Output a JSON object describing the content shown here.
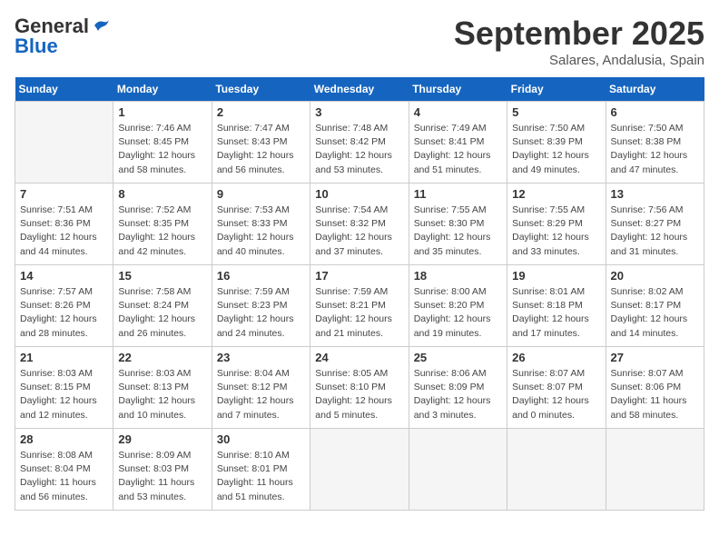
{
  "logo": {
    "line1": "General",
    "line2": "Blue"
  },
  "title": "September 2025",
  "subtitle": "Salares, Andalusia, Spain",
  "days_of_week": [
    "Sunday",
    "Monday",
    "Tuesday",
    "Wednesday",
    "Thursday",
    "Friday",
    "Saturday"
  ],
  "weeks": [
    [
      {
        "day": "",
        "info": ""
      },
      {
        "day": "1",
        "info": "Sunrise: 7:46 AM\nSunset: 8:45 PM\nDaylight: 12 hours\nand 58 minutes."
      },
      {
        "day": "2",
        "info": "Sunrise: 7:47 AM\nSunset: 8:43 PM\nDaylight: 12 hours\nand 56 minutes."
      },
      {
        "day": "3",
        "info": "Sunrise: 7:48 AM\nSunset: 8:42 PM\nDaylight: 12 hours\nand 53 minutes."
      },
      {
        "day": "4",
        "info": "Sunrise: 7:49 AM\nSunset: 8:41 PM\nDaylight: 12 hours\nand 51 minutes."
      },
      {
        "day": "5",
        "info": "Sunrise: 7:50 AM\nSunset: 8:39 PM\nDaylight: 12 hours\nand 49 minutes."
      },
      {
        "day": "6",
        "info": "Sunrise: 7:50 AM\nSunset: 8:38 PM\nDaylight: 12 hours\nand 47 minutes."
      }
    ],
    [
      {
        "day": "7",
        "info": "Sunrise: 7:51 AM\nSunset: 8:36 PM\nDaylight: 12 hours\nand 44 minutes."
      },
      {
        "day": "8",
        "info": "Sunrise: 7:52 AM\nSunset: 8:35 PM\nDaylight: 12 hours\nand 42 minutes."
      },
      {
        "day": "9",
        "info": "Sunrise: 7:53 AM\nSunset: 8:33 PM\nDaylight: 12 hours\nand 40 minutes."
      },
      {
        "day": "10",
        "info": "Sunrise: 7:54 AM\nSunset: 8:32 PM\nDaylight: 12 hours\nand 37 minutes."
      },
      {
        "day": "11",
        "info": "Sunrise: 7:55 AM\nSunset: 8:30 PM\nDaylight: 12 hours\nand 35 minutes."
      },
      {
        "day": "12",
        "info": "Sunrise: 7:55 AM\nSunset: 8:29 PM\nDaylight: 12 hours\nand 33 minutes."
      },
      {
        "day": "13",
        "info": "Sunrise: 7:56 AM\nSunset: 8:27 PM\nDaylight: 12 hours\nand 31 minutes."
      }
    ],
    [
      {
        "day": "14",
        "info": "Sunrise: 7:57 AM\nSunset: 8:26 PM\nDaylight: 12 hours\nand 28 minutes."
      },
      {
        "day": "15",
        "info": "Sunrise: 7:58 AM\nSunset: 8:24 PM\nDaylight: 12 hours\nand 26 minutes."
      },
      {
        "day": "16",
        "info": "Sunrise: 7:59 AM\nSunset: 8:23 PM\nDaylight: 12 hours\nand 24 minutes."
      },
      {
        "day": "17",
        "info": "Sunrise: 7:59 AM\nSunset: 8:21 PM\nDaylight: 12 hours\nand 21 minutes."
      },
      {
        "day": "18",
        "info": "Sunrise: 8:00 AM\nSunset: 8:20 PM\nDaylight: 12 hours\nand 19 minutes."
      },
      {
        "day": "19",
        "info": "Sunrise: 8:01 AM\nSunset: 8:18 PM\nDaylight: 12 hours\nand 17 minutes."
      },
      {
        "day": "20",
        "info": "Sunrise: 8:02 AM\nSunset: 8:17 PM\nDaylight: 12 hours\nand 14 minutes."
      }
    ],
    [
      {
        "day": "21",
        "info": "Sunrise: 8:03 AM\nSunset: 8:15 PM\nDaylight: 12 hours\nand 12 minutes."
      },
      {
        "day": "22",
        "info": "Sunrise: 8:03 AM\nSunset: 8:13 PM\nDaylight: 12 hours\nand 10 minutes."
      },
      {
        "day": "23",
        "info": "Sunrise: 8:04 AM\nSunset: 8:12 PM\nDaylight: 12 hours\nand 7 minutes."
      },
      {
        "day": "24",
        "info": "Sunrise: 8:05 AM\nSunset: 8:10 PM\nDaylight: 12 hours\nand 5 minutes."
      },
      {
        "day": "25",
        "info": "Sunrise: 8:06 AM\nSunset: 8:09 PM\nDaylight: 12 hours\nand 3 minutes."
      },
      {
        "day": "26",
        "info": "Sunrise: 8:07 AM\nSunset: 8:07 PM\nDaylight: 12 hours\nand 0 minutes."
      },
      {
        "day": "27",
        "info": "Sunrise: 8:07 AM\nSunset: 8:06 PM\nDaylight: 11 hours\nand 58 minutes."
      }
    ],
    [
      {
        "day": "28",
        "info": "Sunrise: 8:08 AM\nSunset: 8:04 PM\nDaylight: 11 hours\nand 56 minutes."
      },
      {
        "day": "29",
        "info": "Sunrise: 8:09 AM\nSunset: 8:03 PM\nDaylight: 11 hours\nand 53 minutes."
      },
      {
        "day": "30",
        "info": "Sunrise: 8:10 AM\nSunset: 8:01 PM\nDaylight: 11 hours\nand 51 minutes."
      },
      {
        "day": "",
        "info": ""
      },
      {
        "day": "",
        "info": ""
      },
      {
        "day": "",
        "info": ""
      },
      {
        "day": "",
        "info": ""
      }
    ]
  ]
}
